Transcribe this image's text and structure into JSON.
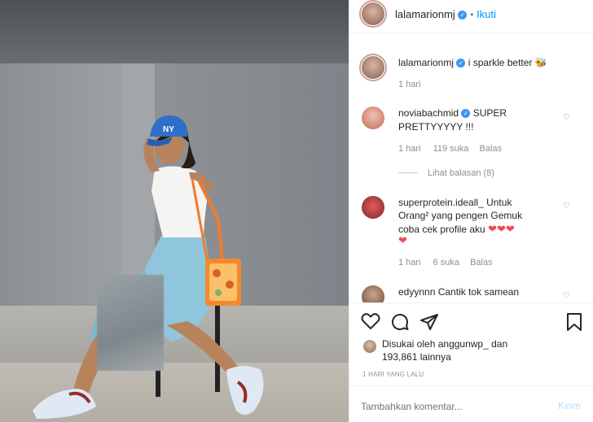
{
  "header": {
    "username": "lalamarionmj",
    "dot": "•",
    "follow_label": "Ikuti"
  },
  "caption": {
    "username": "lalamarionmj",
    "text": "i sparkle better",
    "emoji": "🐝",
    "time": "1 hari"
  },
  "comments": [
    {
      "username": "noviabachmid",
      "text_line1": "SUPER",
      "text_line2": "PRETTYYYYY !!!",
      "time": "1 hari",
      "likes": "119 suka",
      "reply": "Balas",
      "view_replies": "Lihat balasan (8)"
    },
    {
      "username": "superprotein.ideall_",
      "text_line1": "Untuk",
      "text_line2": "Orang² yang pengen Gemuk",
      "text_line3": "coba cek profile aku",
      "time": "1 hari",
      "likes": "6 suka",
      "reply": "Balas"
    },
    {
      "username": "edyynnn",
      "text_line1": "Cantik tok samean"
    }
  ],
  "actions": {
    "like_icon": "heart-outline-icon",
    "comment_icon": "comment-bubble-icon",
    "share_icon": "paper-plane-icon",
    "save_icon": "bookmark-icon"
  },
  "likes": {
    "line1_prefix": "Disukai oleh",
    "liker": "anggunwp_",
    "line1_suffix": "dan",
    "count": "193,861",
    "line2_suffix": "lainnya"
  },
  "timestamp": "1 HARI YANG LALU",
  "comment_box": {
    "placeholder": "Tambahkan komentar...",
    "post_label": "Kirim"
  },
  "colors": {
    "accent": "#0095f6",
    "verified": "#3897f0",
    "heart_red": "#ed4956"
  }
}
